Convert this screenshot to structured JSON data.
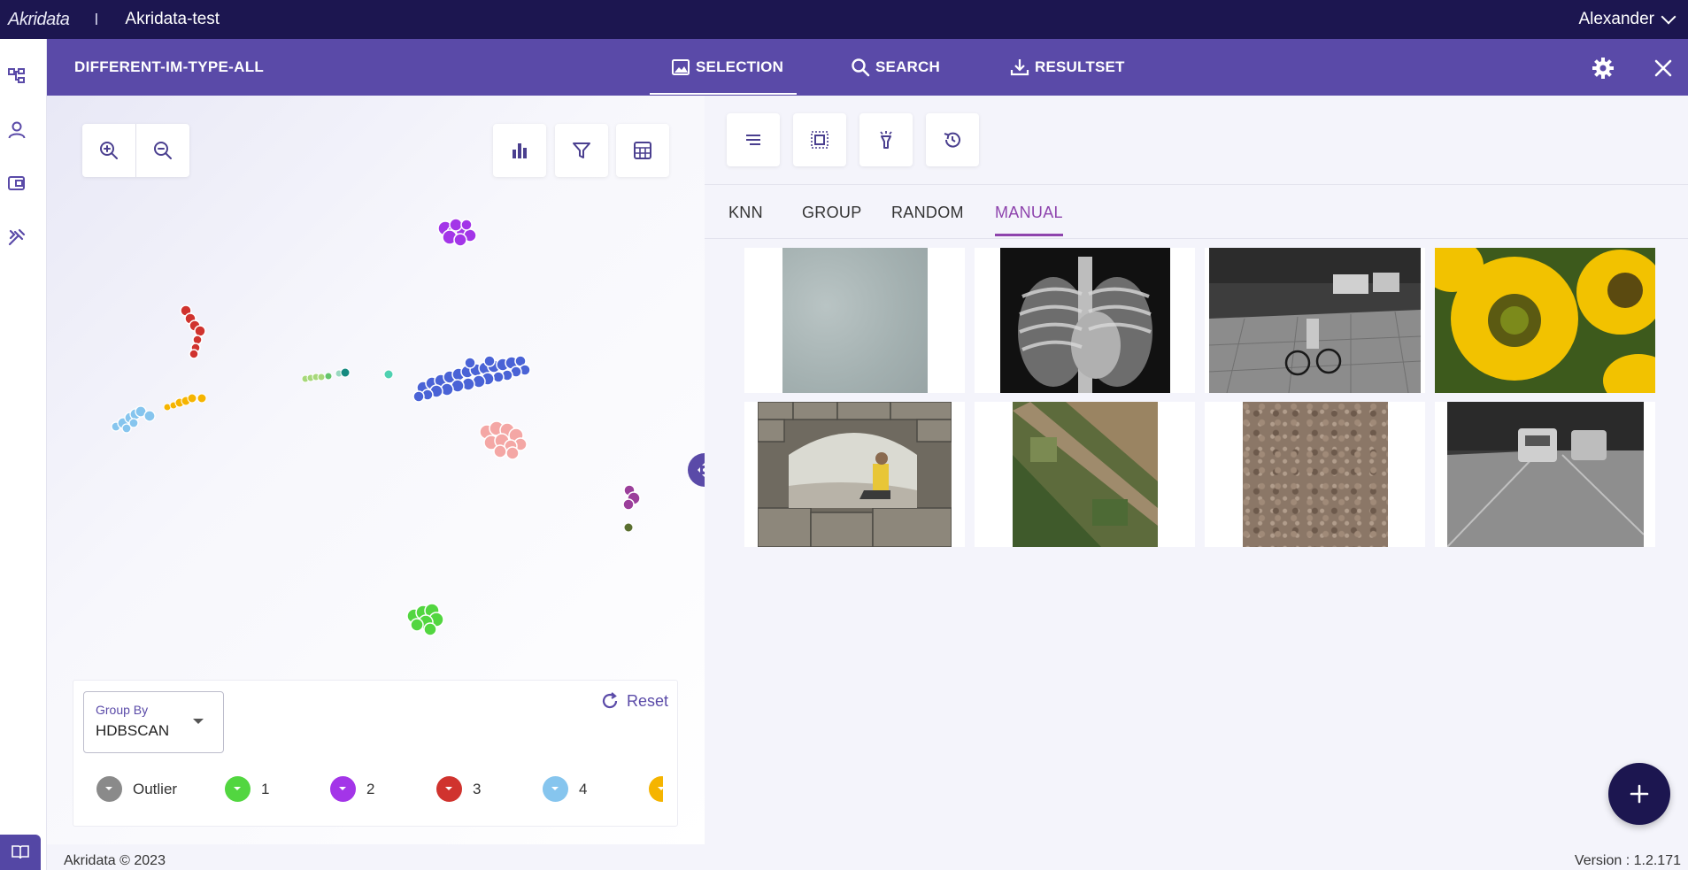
{
  "topbar": {
    "logo": "Akridata",
    "separator": "I",
    "project": "Akridata-test",
    "user": "Alexander"
  },
  "header": {
    "dataset": "DIFFERENT-IM-TYPE-ALL",
    "tabs": [
      {
        "label": "SELECTION",
        "icon": "image-icon",
        "active": true
      },
      {
        "label": "SEARCH",
        "icon": "search-icon",
        "active": false
      },
      {
        "label": "RESULTSET",
        "icon": "download-icon",
        "active": false
      }
    ]
  },
  "selection_tabs": [
    {
      "label": "KNN",
      "active": false
    },
    {
      "label": "GROUP",
      "active": false
    },
    {
      "label": "RANDOM",
      "active": false
    },
    {
      "label": "MANUAL",
      "active": true
    }
  ],
  "group_by": {
    "label": "Group By",
    "value": "HDBSCAN"
  },
  "reset_label": "Reset",
  "legend": [
    {
      "label": "Outlier",
      "color": "#8a8a8a"
    },
    {
      "label": "1",
      "color": "#52d640"
    },
    {
      "label": "2",
      "color": "#a335e8"
    },
    {
      "label": "3",
      "color": "#d0332e"
    },
    {
      "label": "4",
      "color": "#86c5ee"
    },
    {
      "label": "",
      "color": "#f5b400"
    }
  ],
  "colors": {
    "accent": "#5a4aa8",
    "topbar": "#1c1650",
    "active_tab": "#8e44ad"
  },
  "thumbnails": [
    "concrete-texture",
    "chest-xray",
    "cyclist-street-grayscale",
    "sunflowers",
    "stone-arch-person",
    "aerial-farmland",
    "gravel-texture",
    "thermal-road-cars"
  ],
  "footer": {
    "copyright": "Akridata © 2023",
    "version": "Version : 1.2.171"
  }
}
